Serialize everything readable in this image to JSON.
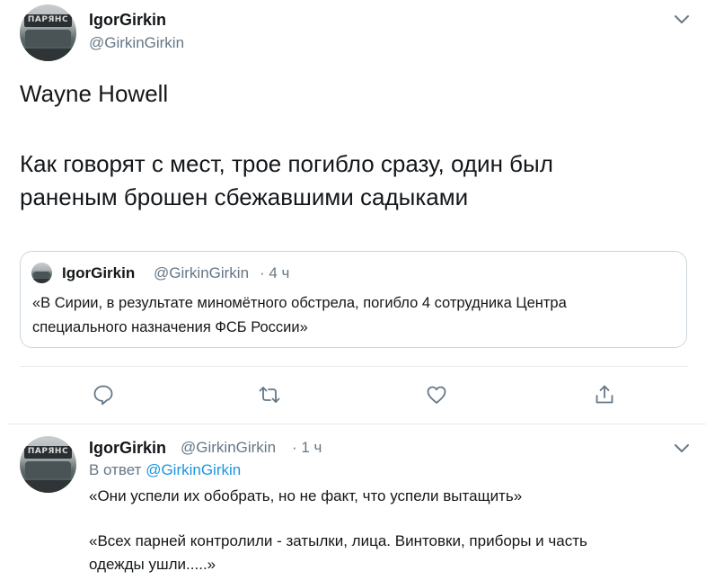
{
  "tweet": {
    "author_name": "IgorGirkin",
    "author_handle": "@GirkinGirkin",
    "avatar_text": "ПАРЯНС",
    "text_line1": "Wayne Howell",
    "text_line2": "Как говорят с мест, трое погибло сразу, один был",
    "text_line3": "раненым брошен сбежавшими садыками",
    "quoted": {
      "author_name": "IgorGirkin",
      "author_handle": "@GirkinGirkin",
      "time": "· 4 ч",
      "text_line1": "«В Сирии, в результате миномётного обстрела, погибло 4 сотрудника Центра",
      "text_line2": "специального назначения ФСБ России»"
    },
    "actions": [
      "reply-icon",
      "retweet-icon",
      "like-icon",
      "share-icon"
    ]
  },
  "reply": {
    "author_name": "IgorGirkin",
    "author_handle": "@GirkinGirkin",
    "time": "· 1 ч",
    "reply_prefix": "В ответ",
    "reply_to": "@GirkinGirkin",
    "text_line1": "«Они успели их обобрать, но не факт, что успели вытащить»",
    "text_line2": "«Всех парней контролили - затылки, лица. Винтовки, приборы и часть",
    "text_line3": "одежды ушли.....»"
  },
  "colors": {
    "text": "#14171a",
    "secondary": "#657786",
    "accent": "#1b95e0",
    "border": "#ccd6dd",
    "divider": "#e6ecf0"
  }
}
